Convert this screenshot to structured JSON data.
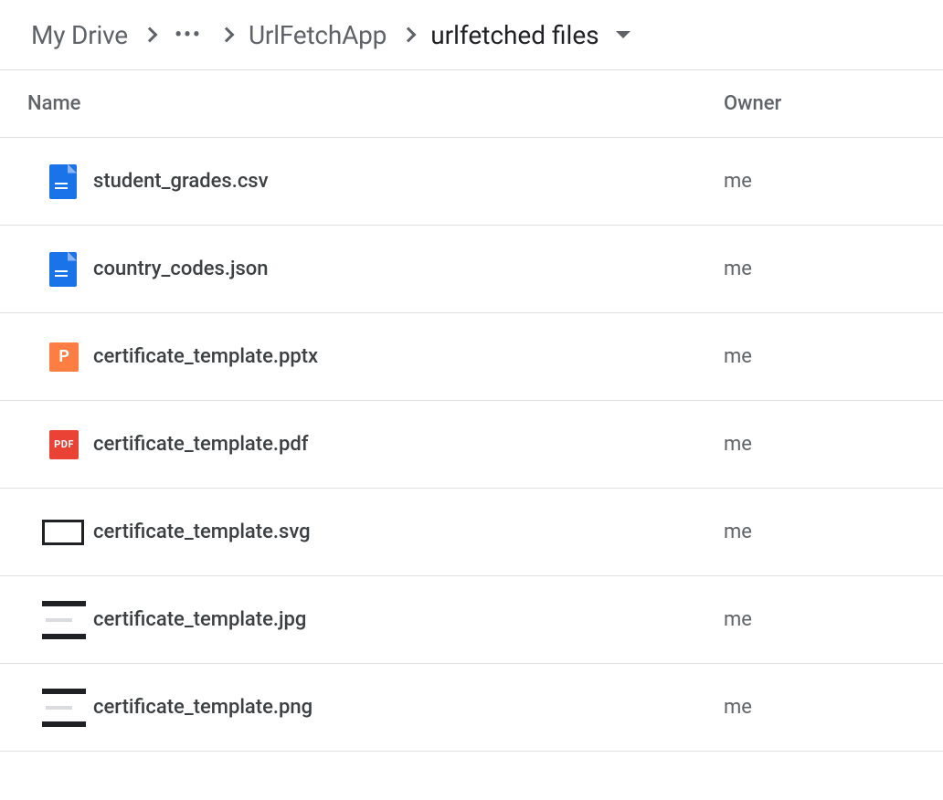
{
  "breadcrumb": {
    "root": "My Drive",
    "ancestor": "UrlFetchApp",
    "current": "urlfetched files"
  },
  "columns": {
    "name": "Name",
    "owner": "Owner"
  },
  "files": [
    {
      "name": "student_grades.csv",
      "owner": "me",
      "icon": "docs"
    },
    {
      "name": "country_codes.json",
      "owner": "me",
      "icon": "docs"
    },
    {
      "name": "certificate_template.pptx",
      "owner": "me",
      "icon": "slides"
    },
    {
      "name": "certificate_template.pdf",
      "owner": "me",
      "icon": "pdf"
    },
    {
      "name": "certificate_template.svg",
      "owner": "me",
      "icon": "svg-thumb"
    },
    {
      "name": "certificate_template.jpg",
      "owner": "me",
      "icon": "image-thumb"
    },
    {
      "name": "certificate_template.png",
      "owner": "me",
      "icon": "image-thumb"
    }
  ]
}
